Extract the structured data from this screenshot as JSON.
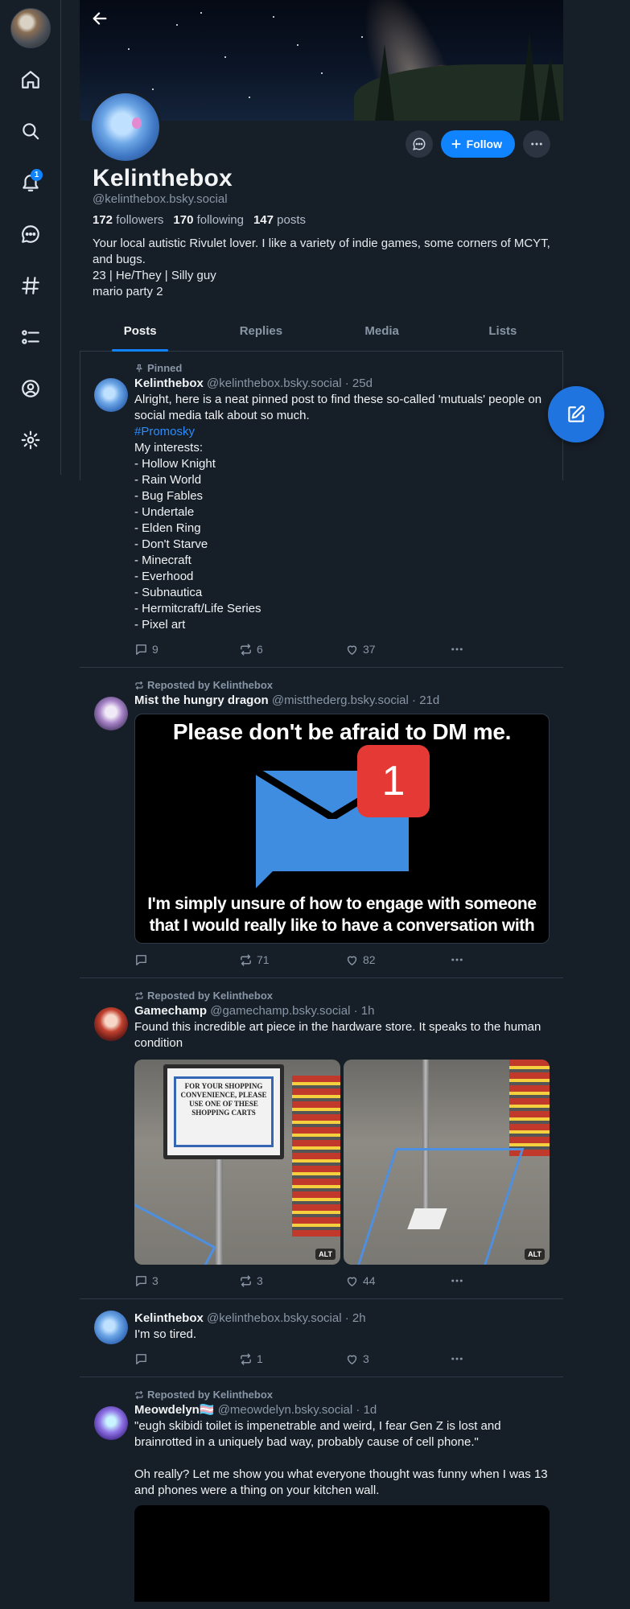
{
  "rail": {
    "notification_count": "1",
    "items": [
      "home",
      "search",
      "notifications",
      "chat",
      "feeds",
      "lists",
      "profile",
      "settings"
    ]
  },
  "profile": {
    "display_name": "Kelinthebox",
    "handle": "@kelinthebox.bsky.social",
    "followers_count": "172",
    "followers_label": "followers",
    "following_count": "170",
    "following_label": "following",
    "posts_count": "147",
    "posts_label": "posts",
    "bio": "Your local autistic Rivulet lover. I like a variety of indie games, some corners of MCYT, and bugs.\n23 | He/They | Silly guy\nmario party 2",
    "follow_label": "Follow"
  },
  "tabs": [
    "Posts",
    "Replies",
    "Media",
    "Lists"
  ],
  "feed": {
    "pinned_post": {
      "pinned_label": "Pinned",
      "author": "Kelinthebox",
      "handle": "@kelinthebox.bsky.social",
      "time": "25d",
      "text_intro": "Alright, here is a neat pinned post to find these so-called 'mutuals' people on social media talk about so much.",
      "hashtag": "#Promosky",
      "text_list": "My interests:\n- Hollow Knight\n- Rain World\n- Bug Fables\n- Undertale\n- Elden Ring\n- Don't Starve\n- Minecraft\n- Everhood\n- Subnautica\n- Hermitcraft/Life Series\n- Pixel art",
      "replies": "9",
      "reposts": "6",
      "likes": "37"
    },
    "repost_mist": {
      "repost_label": "Reposted by Kelinthebox",
      "author": "Mist the hungry dragon",
      "handle": "@mistthederg.bsky.social",
      "time": "21d",
      "image_top_text": "Please don't be afraid to DM me.",
      "image_badge": "1",
      "image_bottom_text": "I'm simply unsure of how to engage with someone that I would really like to have a conversation with",
      "replies": "",
      "reposts": "71",
      "likes": "82"
    },
    "repost_gamechamp": {
      "repost_label": "Reposted by Kelinthebox",
      "author": "Gamechamp",
      "handle": "@gamechamp.bsky.social",
      "time": "1h",
      "text": "Found this incredible art piece in the hardware store. It speaks to the human condition",
      "sign_text": "FOR YOUR SHOPPING CONVENIENCE, PLEASE USE ONE OF THESE SHOPPING CARTS",
      "alt_label": "ALT",
      "replies": "3",
      "reposts": "3",
      "likes": "44"
    },
    "tired_post": {
      "author": "Kelinthebox",
      "handle": "@kelinthebox.bsky.social",
      "time": "2h",
      "text": "I'm so tired.",
      "replies": "",
      "reposts": "1",
      "likes": "3"
    },
    "repost_meowdelyn": {
      "repost_label": "Reposted by Kelinthebox",
      "author": "Meowdelyn🏳️‍⚧️",
      "handle": "@meowdelyn.bsky.social",
      "time": "1d",
      "text": "\"eugh skibidi toilet is impenetrable and weird, I fear Gen Z is lost and brainrotted in a uniquely bad way, probably cause of cell phone.\"\n\nOh really? Let me show you what everyone thought was funny when I was 13 and phones were a thing on your kitchen wall."
    }
  },
  "colors": {
    "background": "#161e27",
    "accent": "#1083fe",
    "muted": "#8896a6",
    "border": "#2e3a48"
  }
}
